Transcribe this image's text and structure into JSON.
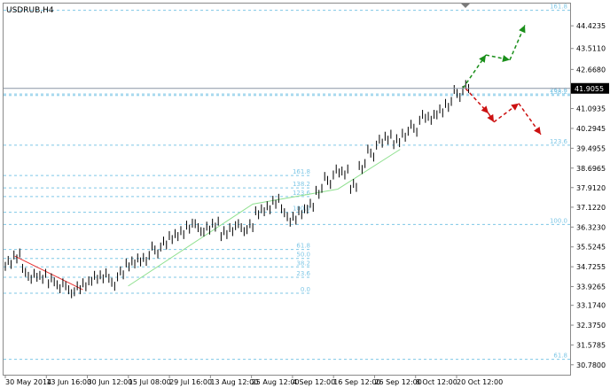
{
  "chart_data": {
    "type": "line",
    "symbol_label": "USDRUB,H4",
    "background": "#ffffff",
    "colors": {
      "frame": "#8a8a8a",
      "candles": "#000000",
      "price_line": "#8a95a5",
      "fib": "#7fc7e6",
      "trend_red": "#e83030",
      "trend_green": "#8fe08f",
      "projection_up": "#1a8f1a",
      "projection_down": "#cc1111",
      "price_badge_bg": "#000000",
      "price_badge_text": "#ffffff"
    },
    "ylim": [
      30.38,
      45.32
    ],
    "y_ticks": [
      "44.4235",
      "43.5110",
      "42.6680",
      "41.9055",
      "41.0935",
      "40.2945",
      "39.4955",
      "38.6965",
      "37.9120",
      "37.1220",
      "36.3230",
      "35.5245",
      "34.7255",
      "33.9265",
      "33.1740",
      "32.3750",
      "31.5785",
      "30.7800"
    ],
    "x_ticks": [
      "30 May 2014",
      "13 Jun 16:00",
      "30 Jun 12:00",
      "15 Jul 08:00",
      "29 Jul 16:00",
      "13 Aug 12:00",
      "25 Aug 12:00",
      "4 Sep 12:00",
      "16 Sep 12:00",
      "26 Sep 12:00",
      "8 Oct 12:00",
      "20 Oct 12:00"
    ],
    "current_price": "41.9055",
    "price_series": [
      34.9,
      35.2,
      34.5,
      34.3,
      34.3,
      34.2,
      34.0,
      33.8,
      33.8,
      34.0,
      34.3,
      34.4,
      34.1,
      34.4,
      34.8,
      35.0,
      35.1,
      35.4,
      35.6,
      35.9,
      36.1,
      36.4,
      36.3,
      36.2,
      36.4,
      36.1,
      36.3,
      36.3,
      36.3,
      36.9,
      37.1,
      37.4,
      36.9,
      36.6,
      36.9,
      37.2,
      37.8,
      38.2,
      38.5,
      38.5,
      38.0,
      38.8,
      39.3,
      39.7,
      39.9,
      39.8,
      40.1,
      40.3,
      40.7,
      40.7,
      41.0,
      41.3,
      41.7,
      41.9
    ],
    "fib_upper": [
      {
        "label": "161.8",
        "value": 45.05
      },
      {
        "label": "261.8",
        "value": 41.68
      },
      {
        "label": "138.2",
        "value": 41.62
      },
      {
        "label": "123.6",
        "value": 39.62
      },
      {
        "label": "100.0",
        "value": 36.43
      },
      {
        "label": "61.8",
        "value": 31.0
      }
    ],
    "fib_lower": [
      {
        "label": "161.8",
        "value": 38.4
      },
      {
        "label": "138.2",
        "value": 37.9
      },
      {
        "label": "123.6",
        "value": 37.55
      },
      {
        "label": "100.0",
        "value": 36.92
      },
      {
        "label": "61.8",
        "value": 35.42
      },
      {
        "label": "50.0",
        "value": 35.06
      },
      {
        "label": "38.2",
        "value": 34.72
      },
      {
        "label": "23.6",
        "value": 34.3
      },
      {
        "label": "0.0",
        "value": 33.66
      }
    ],
    "trend_red": [
      [
        0.02,
        35.15
      ],
      [
        0.14,
        33.8
      ]
    ],
    "trend_green": [
      [
        0.22,
        33.95
      ],
      [
        0.44,
        37.25
      ],
      [
        0.59,
        37.85
      ],
      [
        0.7,
        39.45
      ]
    ],
    "projection_up": [
      [
        41.9055,
        43.25
      ],
      [
        43.25,
        43.05
      ],
      [
        43.05,
        44.45
      ]
    ],
    "projection_down": [
      [
        41.9055,
        40.9
      ],
      [
        40.9,
        40.55
      ],
      [
        40.55,
        41.3
      ],
      [
        41.3,
        40.05
      ]
    ]
  }
}
